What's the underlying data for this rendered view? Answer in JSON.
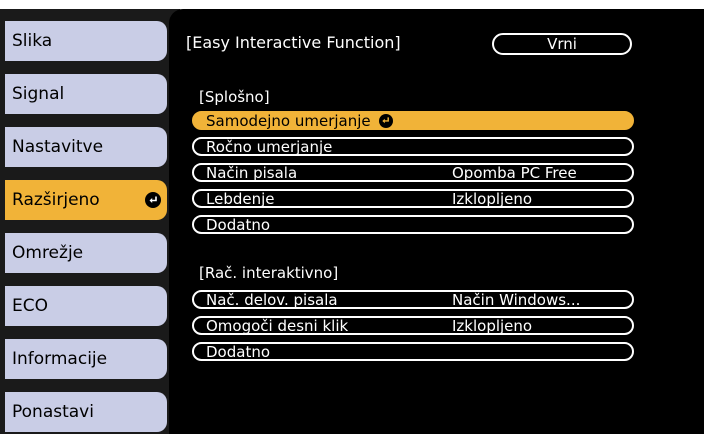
{
  "sidebar": {
    "items": [
      {
        "label": "Slika"
      },
      {
        "label": "Signal"
      },
      {
        "label": "Nastavitve"
      },
      {
        "label": "Razširjeno"
      },
      {
        "label": "Omrežje"
      },
      {
        "label": "ECO"
      },
      {
        "label": "Informacije"
      },
      {
        "label": "Ponastavi"
      }
    ],
    "selected": "Razširjeno"
  },
  "panel": {
    "title": "[Easy Interactive Function]",
    "back_label": "Vrni",
    "sections": [
      {
        "title": "[Splošno]",
        "rows": [
          {
            "label": "Samodejno umerjanje",
            "value": ""
          },
          {
            "label": "Ročno umerjanje",
            "value": ""
          },
          {
            "label": "Način pisala",
            "value": "Opomba PC Free"
          },
          {
            "label": "Lebdenje",
            "value": "Izklopljeno"
          },
          {
            "label": "Dodatno",
            "value": ""
          }
        ]
      },
      {
        "title": "[Rač. interaktivno]",
        "rows": [
          {
            "label": "Nač. delov. pisala",
            "value": "Način Windows..."
          },
          {
            "label": "Omogoči desni klik",
            "value": "Izklopljeno"
          },
          {
            "label": "Dodatno",
            "value": ""
          }
        ]
      }
    ],
    "selected_row": "Samodejno umerjanje"
  },
  "icons": {
    "enter": "enter-icon"
  },
  "colors": {
    "highlight": "#f1b338",
    "sidebar_item": "#c9cde6",
    "panel_bg": "#000000"
  }
}
